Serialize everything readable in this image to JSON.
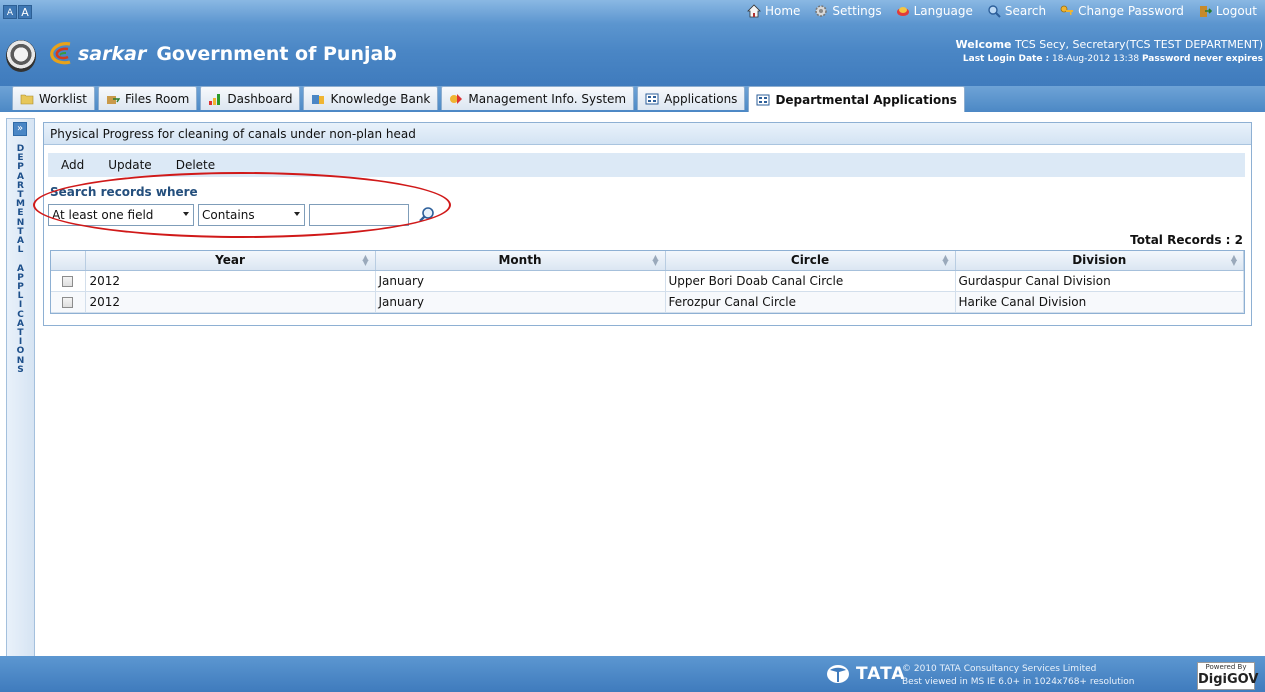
{
  "header": {
    "font_small": "A",
    "font_large": "A",
    "nav": {
      "home": "Home",
      "settings": "Settings",
      "language": "Language",
      "search": "Search",
      "change_password": "Change Password",
      "logout": "Logout"
    },
    "brand_esarkar": "sarkar",
    "brand_title": "Government of Punjab",
    "welcome_label": "Welcome",
    "welcome_user": "TCS Secy, Secretary(TCS TEST DEPARTMENT)",
    "last_login_label": "Last Login Date :",
    "last_login_value": "18-Aug-2012 13:38",
    "password_status": "Password never expires"
  },
  "tabs": [
    {
      "label": "Worklist"
    },
    {
      "label": "Files Room"
    },
    {
      "label": "Dashboard"
    },
    {
      "label": "Knowledge Bank"
    },
    {
      "label": "Management Info. System"
    },
    {
      "label": "Applications"
    },
    {
      "label": "Departmental Applications"
    }
  ],
  "sidebar": {
    "toggle": "»",
    "vertical_text": "DEPARTMENTAL APPLICATIONS"
  },
  "panel": {
    "title": "Physical Progress for cleaning of canals under non-plan head",
    "toolbar": {
      "add": "Add",
      "update": "Update",
      "delete": "Delete"
    },
    "search_label": "Search records where",
    "field_select": "At least one field",
    "operator_select": "Contains",
    "search_value": "",
    "total_records": "Total Records : 2",
    "columns": [
      "Year",
      "Month",
      "Circle",
      "Division"
    ],
    "rows": [
      {
        "year": "2012",
        "month": "January",
        "circle": "Upper Bori Doab Canal  Circle",
        "division": "Gurdaspur Canal Division"
      },
      {
        "year": "2012",
        "month": "January",
        "circle": "Ferozpur Canal Circle",
        "division": "Harike Canal Division"
      }
    ]
  },
  "footer": {
    "tata": "TATA",
    "copyright": "© 2010 TATA Consultancy Services Limited",
    "best_viewed": "Best viewed in MS IE 6.0+ in 1024x768+ resolution",
    "powered_by": "Powered By",
    "digigov": "DigiGOV"
  },
  "colors": {
    "header_blue": "#4a86c5",
    "highlight_red": "#d01919",
    "toolbar_bg": "#dce9f6"
  }
}
